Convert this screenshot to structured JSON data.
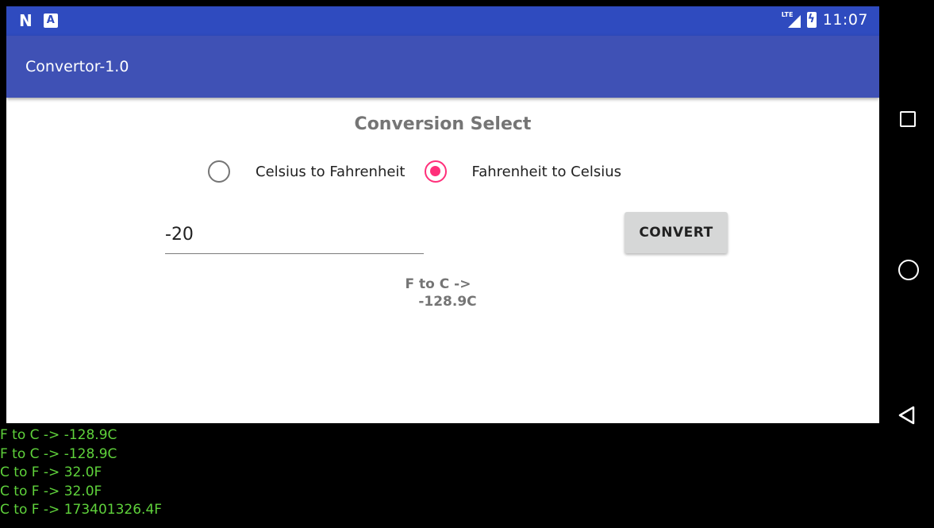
{
  "status_bar": {
    "time": "11:07",
    "network_label": "LTE",
    "icons": [
      "n-icon",
      "a-icon",
      "lte-signal-icon",
      "battery-charging-icon"
    ]
  },
  "app_bar": {
    "title": "Convertor-1.0"
  },
  "main": {
    "heading": "Conversion Select",
    "radio_options": [
      {
        "label": "Celsius to Fahrenheit",
        "checked": false
      },
      {
        "label": "Fahrenheit to Celsius",
        "checked": true
      }
    ],
    "input_value": "-20",
    "convert_label": "CONVERT",
    "result_line1": "F to C ->",
    "result_line2": "-128.9C"
  },
  "log": [
    "F to C -> -128.9C",
    "F to C -> -128.9C",
    "C to F -> 32.0F",
    "C to F -> 32.0F",
    "C to F -> 173401326.4F"
  ],
  "colors": {
    "status_bar": "#2f4bbf",
    "app_bar": "#3f51b5",
    "radio_accent": "#ff2f7a",
    "log_text": "#5fd23b"
  }
}
